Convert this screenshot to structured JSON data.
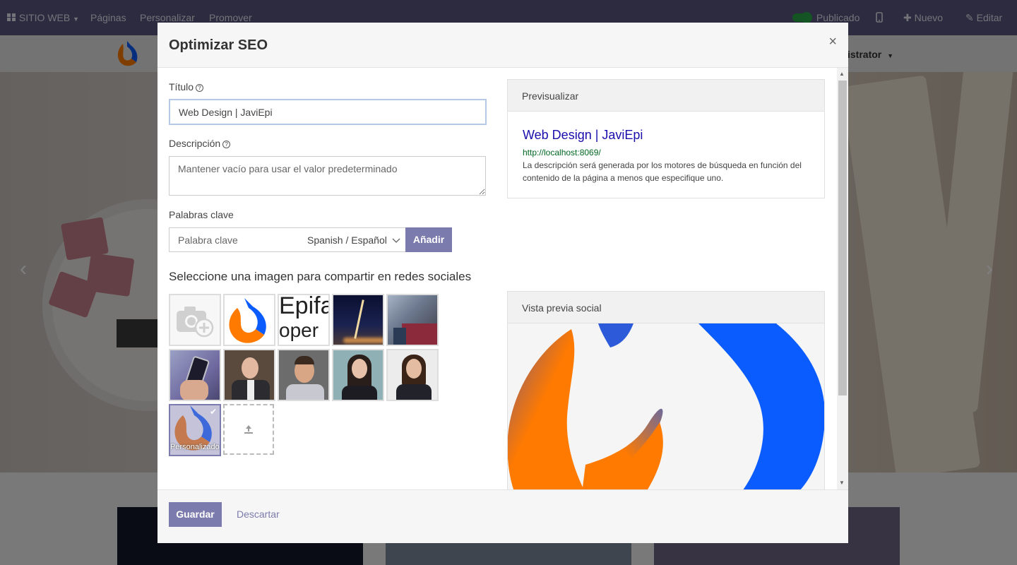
{
  "topbar": {
    "site_menu": "SITIO WEB",
    "pages": "Páginas",
    "customize": "Personalizar",
    "promote": "Promover",
    "published": "Publicado",
    "new": "Nuevo",
    "edit": "Editar"
  },
  "site_header": {
    "user_menu": "istrator"
  },
  "modal": {
    "title": "Optimizar SEO",
    "close_label": "×",
    "title_label": "Título",
    "title_value": "Web Design | JaviEpi",
    "description_label": "Descripción",
    "description_placeholder": "Mantener vacío para usar el valor predeterminado",
    "keywords_label": "Palabras clave",
    "keyword_placeholder": "Palabra clave",
    "language_selected": "Spanish / Español",
    "add_button": "Añadir",
    "social_image_heading": "Seleccione una imagen para compartir en redes sociales",
    "custom_image_label": "Personalizado",
    "preview": {
      "heading": "Previsualizar",
      "result_title": "Web Design | JaviEpi",
      "result_url": "http://localhost:8069/",
      "result_description": "La descripción será generada por los motores de búsqueda en función del contenido de la página a menos que especifique uno."
    },
    "social_preview_heading": "Vista previa social",
    "save_button": "Guardar",
    "discard_button": "Descartar"
  },
  "colors": {
    "brand_purple": "#7c7bad",
    "navbar": "#5b5780",
    "link_blue": "#1a0dab",
    "url_green": "#006621",
    "logo_orange": "#ff7a00",
    "logo_blue": "#0a5cff"
  },
  "icons": [
    "grid-icon",
    "mobile-icon",
    "plus-icon",
    "pencil-icon",
    "help-icon",
    "camera-add-icon",
    "upload-icon",
    "check-icon",
    "chevron-down-icon",
    "close-icon"
  ]
}
